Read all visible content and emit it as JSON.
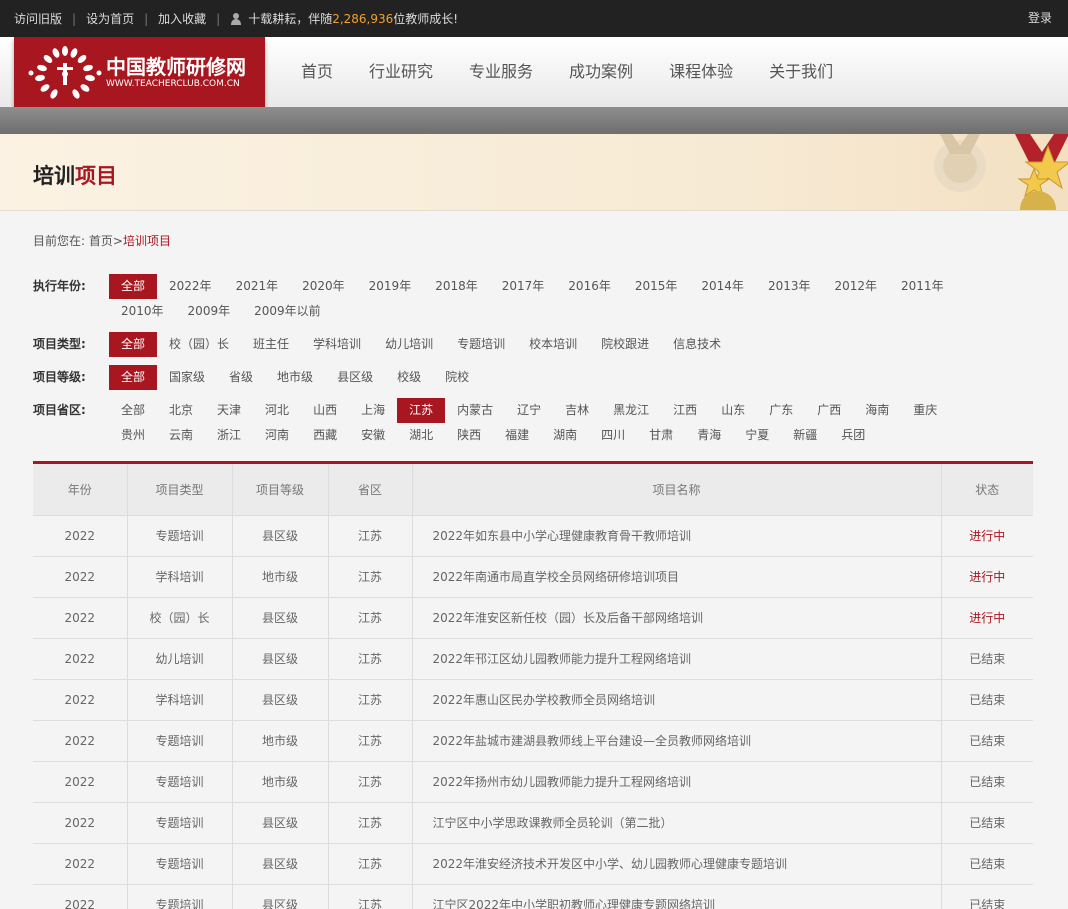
{
  "topbar": {
    "links": [
      "访问旧版",
      "设为首页",
      "加入收藏"
    ],
    "slogan_prefix": "十载耕耘，伴随",
    "teacher_count": "2,286,936",
    "slogan_suffix": "位教师成长!",
    "login": "登录"
  },
  "logo": {
    "cn": "中国教师研修网",
    "en": "WWW.TEACHERCLUB.COM.CN"
  },
  "nav": [
    "首页",
    "行业研究",
    "专业服务",
    "成功案例",
    "课程体验",
    "关于我们"
  ],
  "colors": {
    "brand": "#a8171f",
    "topbar": "#222222",
    "count": "#f0a030"
  },
  "banner": {
    "title_a": "培训",
    "title_b": "项目"
  },
  "breadcrumb": {
    "prefix": "目前您在:",
    "home": "首页",
    "sep": ">",
    "current": "培训项目"
  },
  "filters": [
    {
      "label": "执行年份:",
      "options": [
        "全部",
        "2022年",
        "2021年",
        "2020年",
        "2019年",
        "2018年",
        "2017年",
        "2016年",
        "2015年",
        "2014年",
        "2013年",
        "2012年",
        "2011年",
        "2010年",
        "2009年",
        "2009年以前"
      ],
      "selected": 0
    },
    {
      "label": "项目类型:",
      "options": [
        "全部",
        "校（园）长",
        "班主任",
        "学科培训",
        "幼儿培训",
        "专题培训",
        "校本培训",
        "院校跟进",
        "信息技术"
      ],
      "selected": 0
    },
    {
      "label": "项目等级:",
      "options": [
        "全部",
        "国家级",
        "省级",
        "地市级",
        "县区级",
        "校级",
        "院校"
      ],
      "selected": 0
    },
    {
      "label": "项目省区:",
      "options": [
        "全部",
        "北京",
        "天津",
        "河北",
        "山西",
        "上海",
        "江苏",
        "内蒙古",
        "辽宁",
        "吉林",
        "黑龙江",
        "江西",
        "山东",
        "广东",
        "广西",
        "海南",
        "重庆",
        "贵州",
        "云南",
        "浙江",
        "河南",
        "西藏",
        "安徽",
        "湖北",
        "陕西",
        "福建",
        "湖南",
        "四川",
        "甘肃",
        "青海",
        "宁夏",
        "新疆",
        "兵团"
      ],
      "selected": 6
    }
  ],
  "table": {
    "headers": [
      "年份",
      "项目类型",
      "项目等级",
      "省区",
      "项目名称",
      "状态"
    ],
    "rows": [
      {
        "year": "2022",
        "type": "专题培训",
        "level": "县区级",
        "region": "江苏",
        "name": "2022年如东县中小学心理健康教育骨干教师培训",
        "status": "进行中",
        "active": true
      },
      {
        "year": "2022",
        "type": "学科培训",
        "level": "地市级",
        "region": "江苏",
        "name": "2022年南通市局直学校全员网络研修培训项目",
        "status": "进行中",
        "active": true
      },
      {
        "year": "2022",
        "type": "校（园）长",
        "level": "县区级",
        "region": "江苏",
        "name": "2022年淮安区新任校（园）长及后备干部网络培训",
        "status": "进行中",
        "active": true
      },
      {
        "year": "2022",
        "type": "幼儿培训",
        "level": "县区级",
        "region": "江苏",
        "name": "2022年邗江区幼儿园教师能力提升工程网络培训",
        "status": "已结束",
        "active": false
      },
      {
        "year": "2022",
        "type": "学科培训",
        "level": "县区级",
        "region": "江苏",
        "name": "2022年惠山区民办学校教师全员网络培训",
        "status": "已结束",
        "active": false
      },
      {
        "year": "2022",
        "type": "专题培训",
        "level": "地市级",
        "region": "江苏",
        "name": "2022年盐城市建湖县教师线上平台建设—全员教师网络培训",
        "status": "已结束",
        "active": false
      },
      {
        "year": "2022",
        "type": "专题培训",
        "level": "地市级",
        "region": "江苏",
        "name": "2022年扬州市幼儿园教师能力提升工程网络培训",
        "status": "已结束",
        "active": false
      },
      {
        "year": "2022",
        "type": "专题培训",
        "level": "县区级",
        "region": "江苏",
        "name": "江宁区中小学思政课教师全员轮训（第二批）",
        "status": "已结束",
        "active": false
      },
      {
        "year": "2022",
        "type": "专题培训",
        "level": "县区级",
        "region": "江苏",
        "name": "2022年淮安经济技术开发区中小学、幼儿园教师心理健康专题培训",
        "status": "已结束",
        "active": false
      },
      {
        "year": "2022",
        "type": "专题培训",
        "level": "县区级",
        "region": "江苏",
        "name": "江宁区2022年中小学职初教师心理健康专题网络培训",
        "status": "已结束",
        "active": false
      }
    ]
  }
}
